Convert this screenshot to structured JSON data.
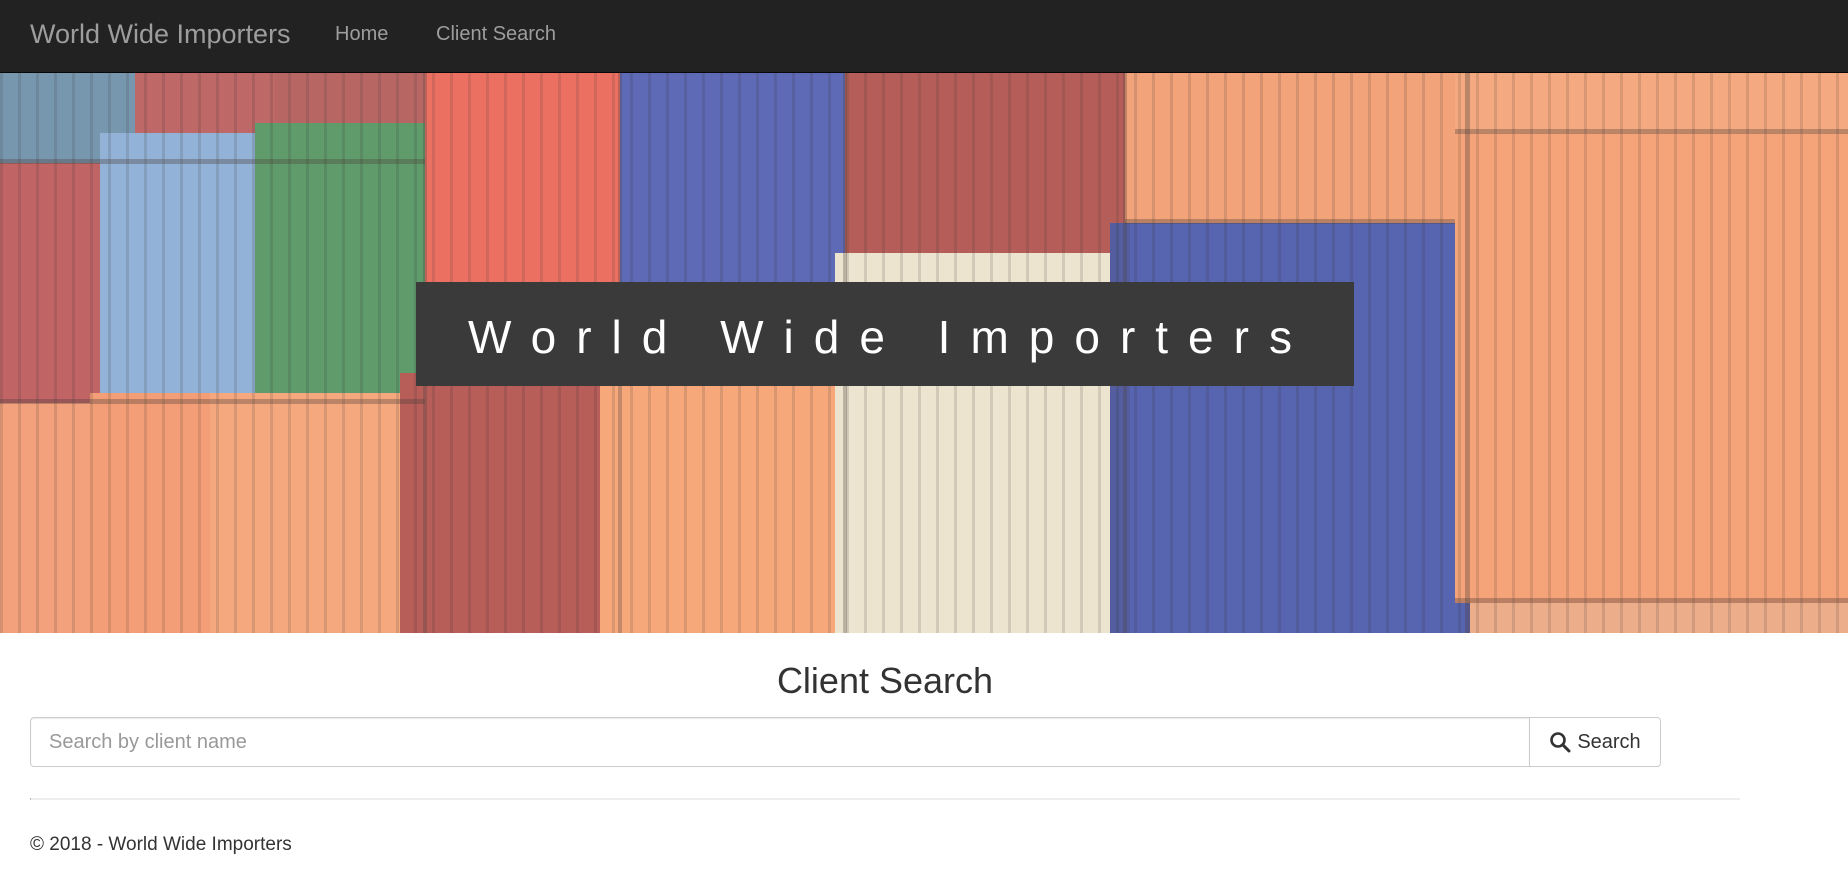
{
  "navbar": {
    "brand": "World Wide Importers",
    "links": [
      {
        "label": "Home"
      },
      {
        "label": "Client Search"
      }
    ]
  },
  "hero": {
    "title": "World Wide Importers"
  },
  "search": {
    "heading": "Client Search",
    "placeholder": "Search by client name",
    "value": "",
    "button_label": "Search",
    "button_icon": "search-icon"
  },
  "footer": {
    "text": "© 2018 - World Wide Importers"
  },
  "colors": {
    "navbar_bg": "#222222",
    "nav_text": "#9d9d9d",
    "title_box_bg": "#3a3a3a",
    "container_orange": "#f0936a",
    "container_blue": "#3a4fa8",
    "container_red": "#b8474a",
    "container_green": "#3f8a57",
    "container_white": "#e9e4d4"
  }
}
